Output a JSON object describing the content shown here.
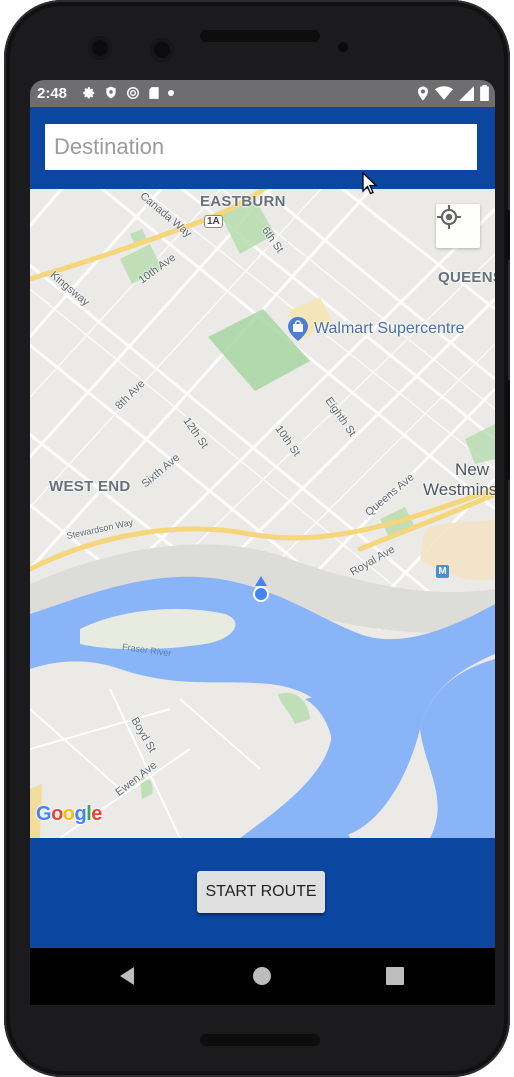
{
  "status_bar": {
    "time": "2:48",
    "left_icons": [
      "gear-icon",
      "shield-icon",
      "at-icon",
      "sd-card-icon",
      "dot-icon"
    ],
    "right_icons": [
      "location-icon",
      "wifi-icon",
      "cellular-icon",
      "battery-icon"
    ]
  },
  "search": {
    "placeholder": "Destination",
    "value": ""
  },
  "map": {
    "labels": {
      "eastburn": "EASTBURN",
      "queens": "QUEENS",
      "west_end": "WEST END",
      "new_westminster_line1": "New",
      "new_westminster_line2": "Westmins",
      "canada_way": "Canada Way",
      "tenth_ave": "10th Ave",
      "kingsway": "Kingsway",
      "sixth_st": "6th St",
      "eighth_ave": "8th Ave",
      "twelfth_st": "12th St",
      "sixth_ave": "Sixth Ave",
      "tenth_st": "10th St",
      "eighth_st": "Eighth St",
      "queens_ave": "Queens Ave",
      "royal_ave": "Royal Ave",
      "stewardson_way": "Stewardson Way",
      "fraser_river": "Fraser River",
      "boyd_st": "Boyd St",
      "ewen_ave": "Ewen Ave"
    },
    "highway_badge": "1A",
    "poi": "Walmart Supercentre",
    "transit_badge": "M",
    "attribution": [
      "G",
      "o",
      "o",
      "g",
      "l",
      "e"
    ]
  },
  "actions": {
    "start_route_label": "START ROUTE"
  },
  "colors": {
    "brand_blue": "#0b47a1",
    "water": "#8ab4f8",
    "park": "#a8d5a2",
    "land": "#ebeae6"
  }
}
